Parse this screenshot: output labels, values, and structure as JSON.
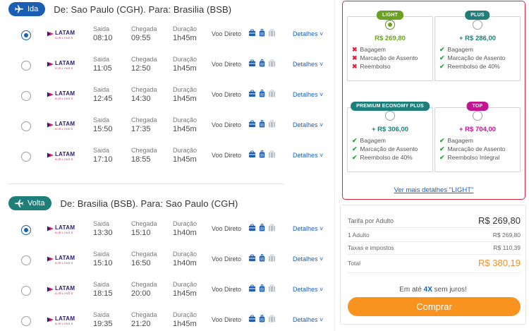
{
  "legs": [
    {
      "label": "Ida",
      "title": "De: Sao Paulo (CGH). Para: Brasilia (BSB)",
      "flights": [
        {
          "dep": "08:10",
          "arr": "09:55",
          "dur": "1h45m",
          "selected": true
        },
        {
          "dep": "11:05",
          "arr": "12:50",
          "dur": "1h45m",
          "selected": false
        },
        {
          "dep": "12:45",
          "arr": "14:30",
          "dur": "1h45m",
          "selected": false
        },
        {
          "dep": "15:50",
          "arr": "17:35",
          "dur": "1h45m",
          "selected": false
        },
        {
          "dep": "17:10",
          "arr": "18:55",
          "dur": "1h45m",
          "selected": false
        }
      ]
    },
    {
      "label": "Volta",
      "title": "De: Brasilia (BSB). Para: Sao Paulo (CGH)",
      "flights": [
        {
          "dep": "13:30",
          "arr": "15:10",
          "dur": "1h40m",
          "selected": true
        },
        {
          "dep": "15:10",
          "arr": "16:50",
          "dur": "1h40m",
          "selected": false
        },
        {
          "dep": "18:15",
          "arr": "20:00",
          "dur": "1h45m",
          "selected": false
        },
        {
          "dep": "19:35",
          "arr": "21:20",
          "dur": "1h45m",
          "selected": false
        }
      ]
    }
  ],
  "labels": {
    "saida": "Saida",
    "chegada": "Chegada",
    "duracao": "Duração",
    "direct": "Voo Direto",
    "details": "Detalhes ˅",
    "airline_name": "LATAM",
    "airline_sub": "AIRLINES"
  },
  "fares": [
    {
      "tag": "LIGHT",
      "color": "#6aa120",
      "price": "R$ 269,80",
      "selected": true,
      "features": [
        {
          "ok": false,
          "text": "Bagagem"
        },
        {
          "ok": false,
          "text": "Marcação de Assento"
        },
        {
          "ok": false,
          "text": "Reembolso"
        }
      ]
    },
    {
      "tag": "PLUS",
      "color": "#1f7d7a",
      "price": "+ R$ 286,00",
      "selected": false,
      "features": [
        {
          "ok": true,
          "text": "Bagagem"
        },
        {
          "ok": true,
          "text": "Marcação de Assento"
        },
        {
          "ok": true,
          "text": "Reembolso de 40%"
        }
      ]
    },
    {
      "tag": "PREMIUM ECONOMY PLUS",
      "color": "#1f7d7a",
      "price": "+ R$ 306,00",
      "selected": false,
      "features": [
        {
          "ok": true,
          "text": "Bagagem"
        },
        {
          "ok": true,
          "text": "Marcação de Assento"
        },
        {
          "ok": true,
          "text": "Reembolso de 40%"
        }
      ]
    },
    {
      "tag": "TOP",
      "color": "#c0178f",
      "price": "+ R$ 704,00",
      "selected": false,
      "features": [
        {
          "ok": true,
          "text": "Bagagem"
        },
        {
          "ok": true,
          "text": "Marcação de Assento"
        },
        {
          "ok": true,
          "text": "Reembolso Integral"
        }
      ]
    }
  ],
  "more_details": "Ver mais detalhes \"LIGHT\"",
  "summary": {
    "fare_label": "Tarifa por Adulto",
    "fare_value": "R$ 269,80",
    "adult_label": "1 Adulto",
    "adult_value": "R$ 269,80",
    "taxes_label": "Taxas e impostos",
    "taxes_value": "R$ 110,39",
    "total_label": "Total",
    "total_value": "R$ 380,19",
    "installments_pre": "Em até ",
    "installments_bold": "4X",
    "installments_post": " sem juros!",
    "buy_label": "Comprar"
  }
}
